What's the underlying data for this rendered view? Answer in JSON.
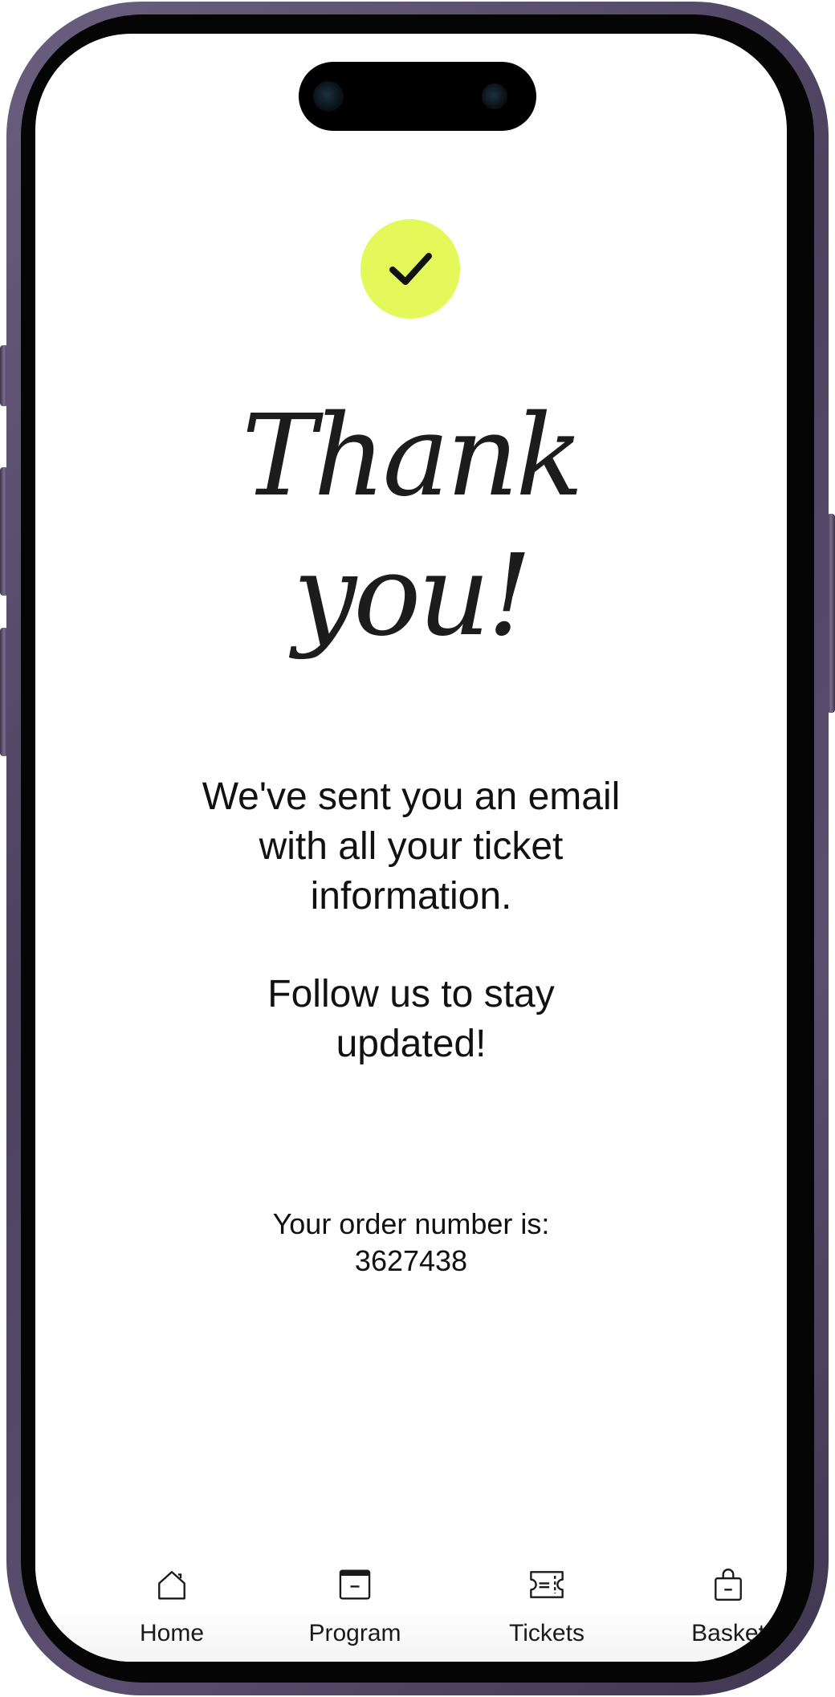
{
  "page": {
    "title_lines": [
      "Thank",
      "you!"
    ],
    "message_lines": [
      "We've sent you an email",
      "with all your ticket",
      "information."
    ],
    "follow_lines": [
      "Follow us to stay",
      "updated!"
    ],
    "order_label": "Your order number is:",
    "order_number": "3627438"
  },
  "status": {
    "icon": "checkmark-icon",
    "badge_color": "#e4f85a"
  },
  "nav": {
    "items": [
      {
        "label": "Home",
        "icon": "home-icon"
      },
      {
        "label": "Program",
        "icon": "calendar-icon"
      },
      {
        "label": "Tickets",
        "icon": "ticket-icon"
      },
      {
        "label": "Basket",
        "icon": "basket-icon"
      }
    ]
  },
  "colors": {
    "accent": "#e4f85a",
    "text": "#111111",
    "frame": "#5b4f70"
  }
}
